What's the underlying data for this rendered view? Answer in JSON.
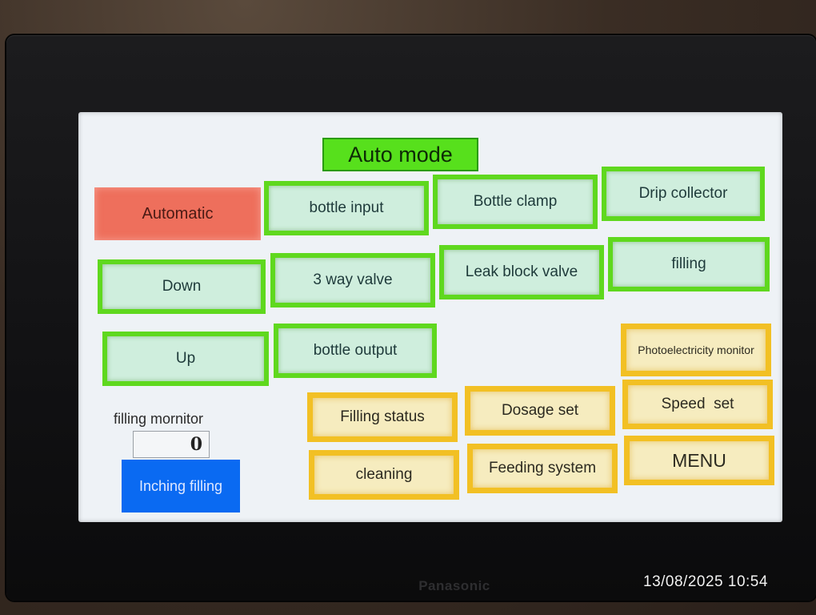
{
  "device": {
    "brand": "Panasonic"
  },
  "screen": {
    "title": "Auto mode",
    "buttons": {
      "automatic": "Automatic",
      "bottle_input": "bottle input",
      "bottle_clamp": "Bottle clamp",
      "drip_collector": "Drip collector",
      "down": "Down",
      "three_way_valve": "3 way valve",
      "leak_block_valve": "Leak block valve",
      "filling": "filling",
      "up": "Up",
      "bottle_output": "bottle output",
      "photoelectricity_monitor": "Photoelectricity monitor",
      "filling_status": "Filling status",
      "dosage_set": "Dosage set",
      "speed_set": "Speed  set",
      "cleaning": "cleaning",
      "feeding_system": "Feeding system",
      "menu": "MENU",
      "inching_filling": "Inching filling"
    },
    "filling_monitor": {
      "label": "filling mornitor",
      "value": "0"
    }
  },
  "photo_timestamp": "13/08/2025 10:54",
  "colors": {
    "title_green": "#57e01c",
    "button_green": "#5fd81e",
    "active_red": "#ee6f5c",
    "amber": "#f2c024",
    "blue": "#0a6af2"
  }
}
